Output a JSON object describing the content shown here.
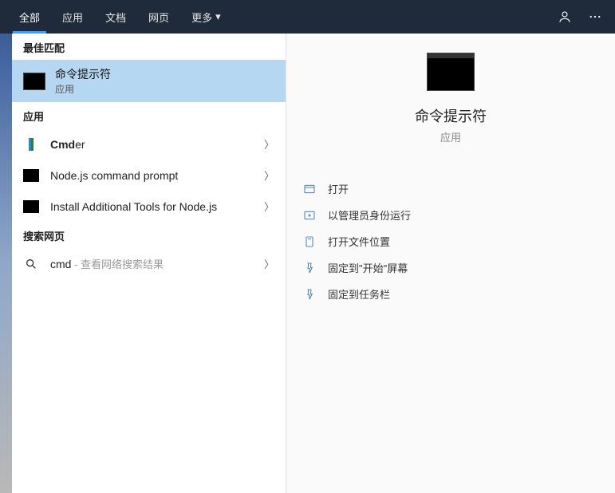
{
  "tabs": {
    "all": "全部",
    "apps": "应用",
    "docs": "文档",
    "web": "网页",
    "more": "更多"
  },
  "sections": {
    "best_match": "最佳匹配",
    "apps": "应用",
    "web": "搜索网页"
  },
  "best_match": {
    "title": "命令提示符",
    "subtitle": "应用"
  },
  "apps_list": [
    {
      "name_bold": "Cmd",
      "name_rest": "er",
      "icon": "cmder"
    },
    {
      "name_bold": "",
      "name_rest": "Node.js command prompt",
      "icon": "black"
    },
    {
      "name_bold": "",
      "name_rest": "Install Additional Tools for Node.js",
      "icon": "black"
    }
  ],
  "web_search": {
    "query": "cmd",
    "hint": " - 查看网络搜索结果"
  },
  "preview": {
    "title": "命令提示符",
    "subtitle": "应用"
  },
  "actions": {
    "open": "打开",
    "run_admin": "以管理员身份运行",
    "open_location": "打开文件位置",
    "pin_start": "固定到\"开始\"屏幕",
    "pin_taskbar": "固定到任务栏"
  }
}
